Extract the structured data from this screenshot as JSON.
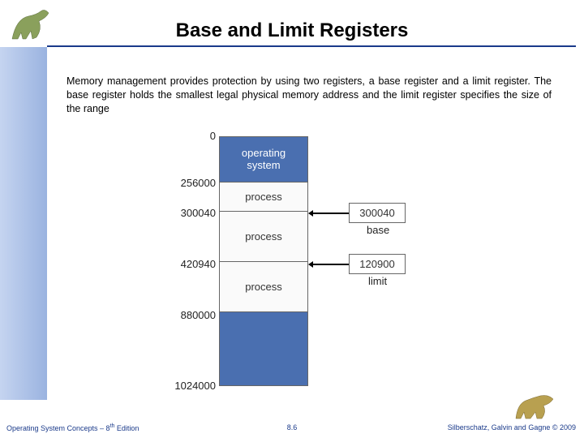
{
  "title": "Base and Limit Registers",
  "body": "Memory management provides protection by using two registers, a base register and a limit register. The base register holds the smallest legal physical memory address and the limit register specifies the size of the range",
  "memory": {
    "addrs": [
      "0",
      "256000",
      "300040",
      "420940",
      "880000",
      "1024000"
    ],
    "cells": {
      "os": "operating\nsystem",
      "p1": "process",
      "p2": "process",
      "p3": "process"
    }
  },
  "registers": {
    "base_value": "300040",
    "base_label": "base",
    "limit_value": "120900",
    "limit_label": "limit"
  },
  "footer": {
    "left_a": "Operating System Concepts – 8",
    "left_b": " Edition",
    "left_sup": "th",
    "center": "8.6",
    "right": "Silberschatz, Galvin and Gagne © 2009"
  }
}
